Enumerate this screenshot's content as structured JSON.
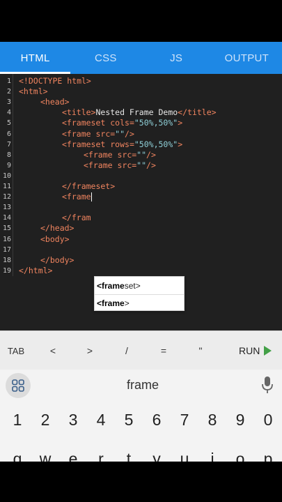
{
  "tabs": [
    {
      "label": "HTML",
      "active": true
    },
    {
      "label": "CSS",
      "active": false
    },
    {
      "label": "JS",
      "active": false
    },
    {
      "label": "OUTPUT",
      "active": false
    }
  ],
  "editor": {
    "lines": [
      {
        "n": "1",
        "indent": 0,
        "parts": [
          [
            "tag",
            "<!DOCTYPE html>"
          ]
        ]
      },
      {
        "n": "2",
        "indent": 0,
        "parts": [
          [
            "tag",
            "<html>"
          ]
        ]
      },
      {
        "n": "3",
        "indent": 1,
        "parts": [
          [
            "tag",
            "<head>"
          ]
        ]
      },
      {
        "n": "4",
        "indent": 2,
        "parts": [
          [
            "tag",
            "<title>"
          ],
          [
            "txt",
            "Nested Frame Demo"
          ],
          [
            "tag",
            "</title>"
          ]
        ]
      },
      {
        "n": "5",
        "indent": 2,
        "parts": [
          [
            "tag",
            "<frameset "
          ],
          [
            "attr",
            "cols="
          ],
          [
            "val",
            "\"50%,50%\""
          ],
          [
            "tag",
            ">"
          ]
        ]
      },
      {
        "n": "6",
        "indent": 2,
        "parts": [
          [
            "tag",
            "<frame "
          ],
          [
            "attr",
            "src="
          ],
          [
            "val",
            "\"\""
          ],
          [
            "tag",
            "/>"
          ]
        ]
      },
      {
        "n": "7",
        "indent": 2,
        "parts": [
          [
            "tag",
            "<frameset "
          ],
          [
            "attr",
            "rows="
          ],
          [
            "val",
            "\"50%,50%\""
          ],
          [
            "tag",
            ">"
          ]
        ]
      },
      {
        "n": "8",
        "indent": 3,
        "parts": [
          [
            "tag",
            "<frame "
          ],
          [
            "attr",
            "src="
          ],
          [
            "val",
            "\"\""
          ],
          [
            "tag",
            "/>"
          ]
        ]
      },
      {
        "n": "9",
        "indent": 3,
        "parts": [
          [
            "tag",
            "<frame "
          ],
          [
            "attr",
            "src="
          ],
          [
            "val",
            "\"\""
          ],
          [
            "tag",
            "/>"
          ]
        ]
      },
      {
        "n": "10",
        "indent": 0,
        "parts": []
      },
      {
        "n": "11",
        "indent": 2,
        "parts": [
          [
            "tag",
            "</frameset>"
          ]
        ]
      },
      {
        "n": "12",
        "indent": 2,
        "parts": [
          [
            "tag",
            "<frame"
          ],
          [
            "cursor",
            ""
          ]
        ]
      },
      {
        "n": "13",
        "indent": 0,
        "parts": []
      },
      {
        "n": "14",
        "indent": 2,
        "parts": [
          [
            "tag",
            "</fram"
          ]
        ]
      },
      {
        "n": "15",
        "indent": 1,
        "parts": [
          [
            "tag",
            "</head>"
          ]
        ]
      },
      {
        "n": "16",
        "indent": 1,
        "parts": [
          [
            "tag",
            "<body>"
          ]
        ]
      },
      {
        "n": "17",
        "indent": 0,
        "parts": []
      },
      {
        "n": "18",
        "indent": 1,
        "parts": [
          [
            "tag",
            "</body>"
          ]
        ]
      },
      {
        "n": "19",
        "indent": 0,
        "parts": [
          [
            "tag",
            "</html>"
          ]
        ]
      }
    ]
  },
  "autocomplete": {
    "items": [
      {
        "match": "<frame",
        "rest": "set>"
      },
      {
        "match": "<frame",
        "rest": ">"
      }
    ]
  },
  "keysbar": {
    "keys": [
      "TAB",
      "<",
      ">",
      "/",
      "=",
      "\""
    ],
    "run_label": "RUN"
  },
  "keyboard": {
    "suggestion": "frame",
    "digits": [
      "1",
      "2",
      "3",
      "4",
      "5",
      "6",
      "7",
      "8",
      "9",
      "0"
    ],
    "letters": [
      "q",
      "w",
      "e",
      "r",
      "t",
      "y",
      "u",
      "i",
      "o",
      "p"
    ]
  },
  "colors": {
    "tab_bar": "#1e88e5",
    "editor_bg": "#202020",
    "tag": "#f0845f",
    "string": "#8fd0d8",
    "run_icon": "#43a047"
  }
}
